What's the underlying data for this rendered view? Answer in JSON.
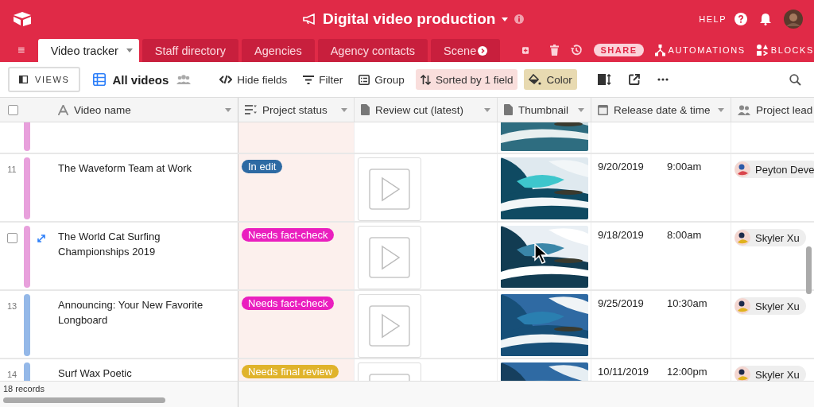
{
  "app": {
    "title": "Digital video production",
    "help": "HELP"
  },
  "tabs": [
    {
      "label": "Video tracker",
      "selected": true
    },
    {
      "label": "Staff directory",
      "selected": false
    },
    {
      "label": "Agencies",
      "selected": false
    },
    {
      "label": "Agency contacts",
      "selected": false
    },
    {
      "label": "Scene",
      "selected": false
    }
  ],
  "tab_actions": {
    "share": "SHARE",
    "automations": "AUTOMATIONS",
    "blocks": "BLOCKS"
  },
  "toolbar": {
    "views": "VIEWS",
    "view_name": "All videos",
    "buttons": [
      {
        "label": "Hide fields",
        "kind": "hide"
      },
      {
        "label": "Filter",
        "kind": "filter"
      },
      {
        "label": "Group",
        "kind": "group"
      },
      {
        "label": "Sorted by 1 field",
        "kind": "sort"
      },
      {
        "label": "Color",
        "kind": "color"
      }
    ]
  },
  "header_checkbox": {
    "checked": false
  },
  "columns": [
    {
      "label": "Video name",
      "kind": "text"
    },
    {
      "label": "Project status",
      "kind": "select"
    },
    {
      "label": "Review cut (latest)",
      "kind": "file"
    },
    {
      "label": "Thumbnail",
      "kind": "file"
    },
    {
      "label": "Release date & time",
      "kind": "date"
    },
    {
      "label": "Project lead",
      "kind": "person"
    }
  ],
  "rows": [
    {
      "hovered": false,
      "color": "#e8a0dc"
    },
    {
      "number": "11",
      "hovered": false,
      "color": "#e8a0dc",
      "name": "The Waveform Team at Work",
      "status": {
        "label": "In edit",
        "color": "#2d6aa3"
      },
      "review": {
        "kind": "placeholder"
      },
      "date": "9/20/2019",
      "time": "9:00am",
      "lead": "Peyton Deve"
    },
    {
      "hovered": true,
      "checked": false,
      "color": "#e8a0dc",
      "name": "The World Cat Surfing Championships 2019",
      "status": {
        "label": "Needs fact-check",
        "color": "#ea1fbf"
      },
      "review": {
        "kind": "placeholder"
      },
      "date": "9/18/2019",
      "time": "8:00am",
      "lead": "Skyler Xu"
    },
    {
      "number": "13",
      "hovered": false,
      "color": "#94b8e8",
      "name": "Announcing: Your New Favorite Longboard",
      "status": {
        "label": "Needs fact-check",
        "color": "#ea1fbf"
      },
      "review": {
        "kind": "placeholder"
      },
      "date": "9/25/2019",
      "time": "10:30am",
      "lead": "Skyler Xu"
    },
    {
      "number": "14",
      "hovered": false,
      "color": "#94b8e8",
      "name": "Surf Wax Poetic",
      "status": {
        "label": "Needs final review",
        "color": "#e0b32b"
      },
      "review": {
        "kind": "placeholder"
      },
      "date": "10/11/2019",
      "time": "12:00pm",
      "lead": "Skyler Xu"
    }
  ],
  "footer": {
    "records": "18 records"
  }
}
